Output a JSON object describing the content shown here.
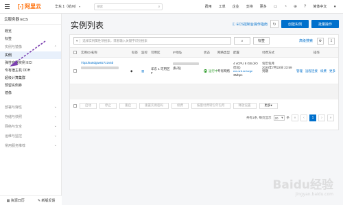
{
  "topbar": {
    "logo_text": "阿里云",
    "region": "华东 1（杭州）",
    "search_placeholder": "搜索",
    "links": [
      "费用",
      "工单",
      "企业",
      "支持",
      "更多",
      "简体中文"
    ]
  },
  "sidebar": {
    "title": "云服务器 ECS",
    "items": [
      "概览",
      "标签",
      "实例与镜像",
      "实例",
      "弹性容器实例 ECI",
      "专有宿主机 DDH",
      "超级计算集群",
      "预留实例券",
      "镜像"
    ],
    "groups": [
      "部署与弹性",
      "存储与快照",
      "网络与安全",
      "运维与监控",
      "常用服务推荐"
    ],
    "footer": [
      "资源日历",
      "新版反馈"
    ]
  },
  "main": {
    "title": "实例列表",
    "help_link": "ECS控制台操作指南",
    "create_button": "创建实例",
    "bulk_button": "批量操作",
    "filter": {
      "select_placeholder": "选择实例属性项搜索，或者输入关键字识别搜索",
      "search_button": "标签",
      "advanced_search": "高级搜索"
    },
    "columns": [
      "实例ID/名称",
      "标签",
      "监控",
      "可用区",
      "IP地址",
      "状态",
      "网络类型",
      "配置",
      "付费方式",
      "操作"
    ],
    "row": {
      "instance_id": "i-bp1l6u8dgtw8z7z2v5b",
      "zone": "华东 1 可用区 F",
      "ip_label": "(私有)",
      "status": "运行中",
      "network": "专有网络",
      "config": "4 vCPU 8 GB (I/O优化)",
      "config_type": "ecs.sn1ne.large",
      "bandwidth": "3Mbps",
      "billing": "包年包月",
      "expire": "2020年7月22日 23:59 到期",
      "actions": [
        "管理",
        "远程连接",
        "续费",
        "更多"
      ]
    },
    "bulk_actions": [
      "启动",
      "停止",
      "重启",
      "重置实例密码",
      "续费",
      "按量付费转包年包月",
      "释放设置",
      "更多"
    ],
    "pager": {
      "summary": "共有1条, 每页显示",
      "page_size": "20",
      "page_unit": "条",
      "current": "1"
    }
  },
  "watermark": {
    "text": "Baidu经验",
    "sub": "jingyan.baidu.com"
  }
}
